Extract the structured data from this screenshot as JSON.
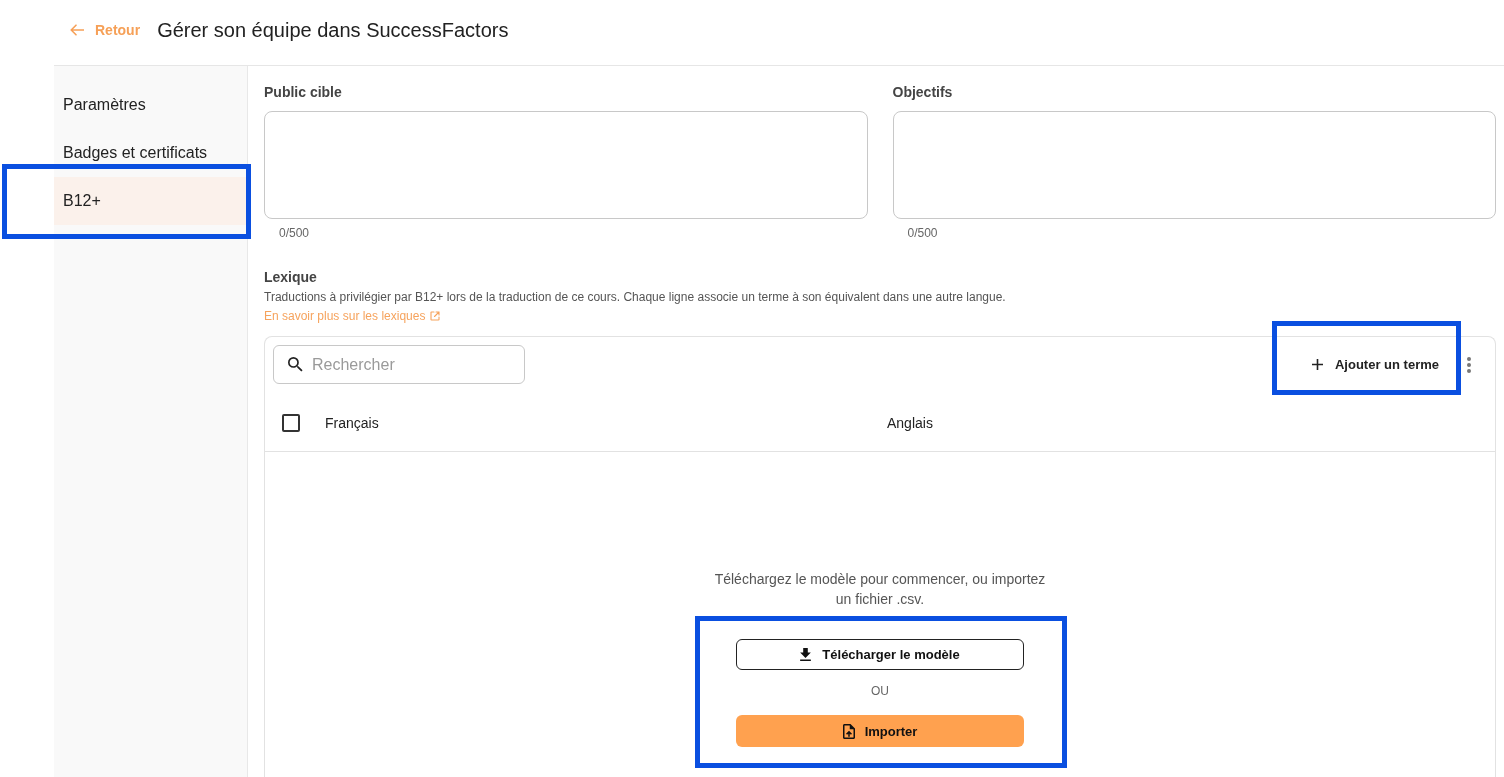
{
  "header": {
    "back_link": "Retour",
    "title": "Gérer son équipe dans SuccessFactors"
  },
  "sidebar": {
    "items": [
      {
        "label": "Paramètres",
        "selected": false,
        "highlighted": false
      },
      {
        "label": "Badges et certificats",
        "selected": false,
        "highlighted": false
      },
      {
        "label": "B12+",
        "selected": true,
        "highlighted": true
      }
    ]
  },
  "fields": [
    {
      "label": "Public cible",
      "counter": "0/500"
    },
    {
      "label": "Objectifs",
      "counter": "0/500"
    }
  ],
  "lexicon": {
    "title": "Lexique",
    "description": "Traductions à privilégier par B12+ lors de la traduction de ce cours. Chaque ligne associe un terme à son équivalent dans une autre langue.",
    "link": "En savoir plus sur les lexiques",
    "search": {
      "placeholder": "Rechercher"
    },
    "add_button": {
      "label": "Ajouter un terme",
      "highlighted": true
    },
    "table": {
      "select_all_checked": false,
      "columns": [
        "Français",
        "Anglais"
      ]
    },
    "empty_state": {
      "message": "Téléchargez le modèle pour commencer, ou importez un fichier .csv.",
      "download_button": "Télécharger le modèle",
      "separator": "OU",
      "import_button": "Importer",
      "highlighted": true
    }
  }
}
